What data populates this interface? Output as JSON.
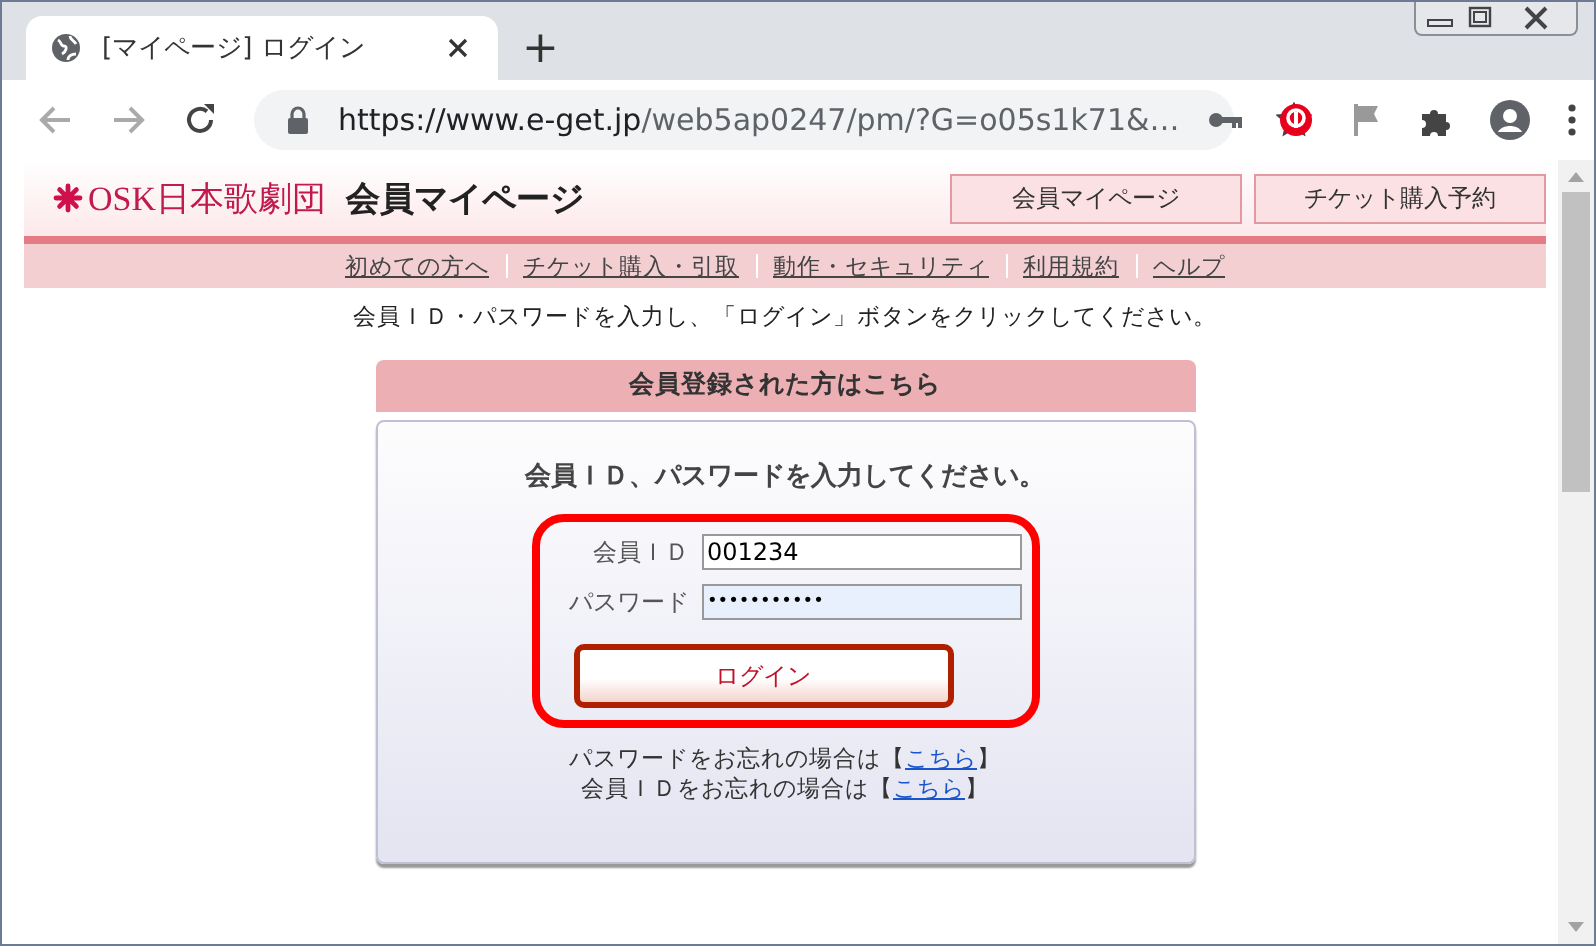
{
  "browser": {
    "tab": {
      "title": "[マイページ] ログイン",
      "selected": true
    },
    "new_tab": "+",
    "url": {
      "host": "https://www.e-get.jp",
      "path": "/web5ap0247/pm/?G=o05s1k71&…"
    }
  },
  "header": {
    "logo": "OSK日本歌劇団",
    "title": "会員マイページ",
    "buttons": [
      "会員マイページ",
      "チケット購入予約"
    ]
  },
  "nav": [
    "初めての方へ",
    "チケット購入・引取",
    "動作・セキュリティ",
    "利用規約",
    "ヘルプ"
  ],
  "instruction": "会員ＩＤ・パスワードを入力し、「ログイン」ボタンをクリックしてください。",
  "login": {
    "heading": "会員登録された方はこちら",
    "prompt": "会員ＩＤ、パスワードを入力してください。",
    "fields": [
      {
        "label": "会員ＩＤ",
        "value": "001234",
        "kind": "text"
      },
      {
        "label": "パスワード",
        "value": "•••••••••••",
        "kind": "password"
      }
    ],
    "button": "ログイン",
    "help": [
      {
        "text": "パスワードをお忘れの場合は【",
        "link": "こちら",
        "after": "】"
      },
      {
        "text": "会員ＩＤをお忘れの場合は【",
        "link": "こちら",
        "after": "】"
      }
    ]
  }
}
